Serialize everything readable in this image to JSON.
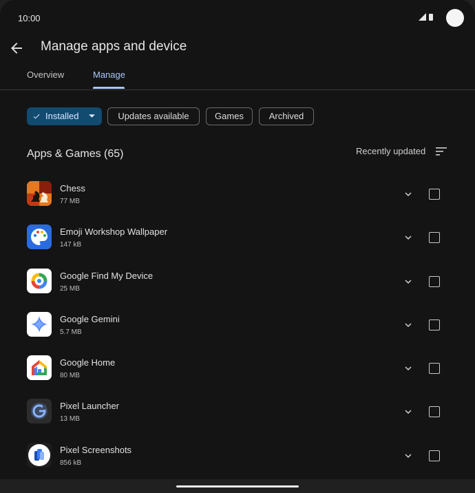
{
  "status": {
    "time": "10:00"
  },
  "header": {
    "title": "Manage apps and device"
  },
  "tabs": [
    {
      "label": "Overview",
      "active": false
    },
    {
      "label": "Manage",
      "active": true
    }
  ],
  "filters": [
    {
      "label": "Installed",
      "selected": true
    },
    {
      "label": "Updates available",
      "selected": false
    },
    {
      "label": "Games",
      "selected": false
    },
    {
      "label": "Archived",
      "selected": false
    }
  ],
  "section": {
    "title": "Apps & Games (65)",
    "sort_label": "Recently updated"
  },
  "apps": [
    {
      "name": "Chess",
      "size": "77 MB",
      "icon": "chess-icon"
    },
    {
      "name": "Emoji Workshop Wallpaper",
      "size": "147 kB",
      "icon": "emoji-workshop-icon"
    },
    {
      "name": "Google Find My Device",
      "size": "25 MB",
      "icon": "find-my-device-icon"
    },
    {
      "name": "Google Gemini",
      "size": "5.7 MB",
      "icon": "gemini-icon"
    },
    {
      "name": "Google Home",
      "size": "80 MB",
      "icon": "google-home-icon"
    },
    {
      "name": "Pixel Launcher",
      "size": "13 MB",
      "icon": "pixel-launcher-icon"
    },
    {
      "name": "Pixel Screenshots",
      "size": "856 kB",
      "icon": "pixel-screenshots-icon"
    }
  ],
  "colors": {
    "accent": "#a8c7fa",
    "chip_selected_bg": "#124a70",
    "background": "#141414"
  }
}
